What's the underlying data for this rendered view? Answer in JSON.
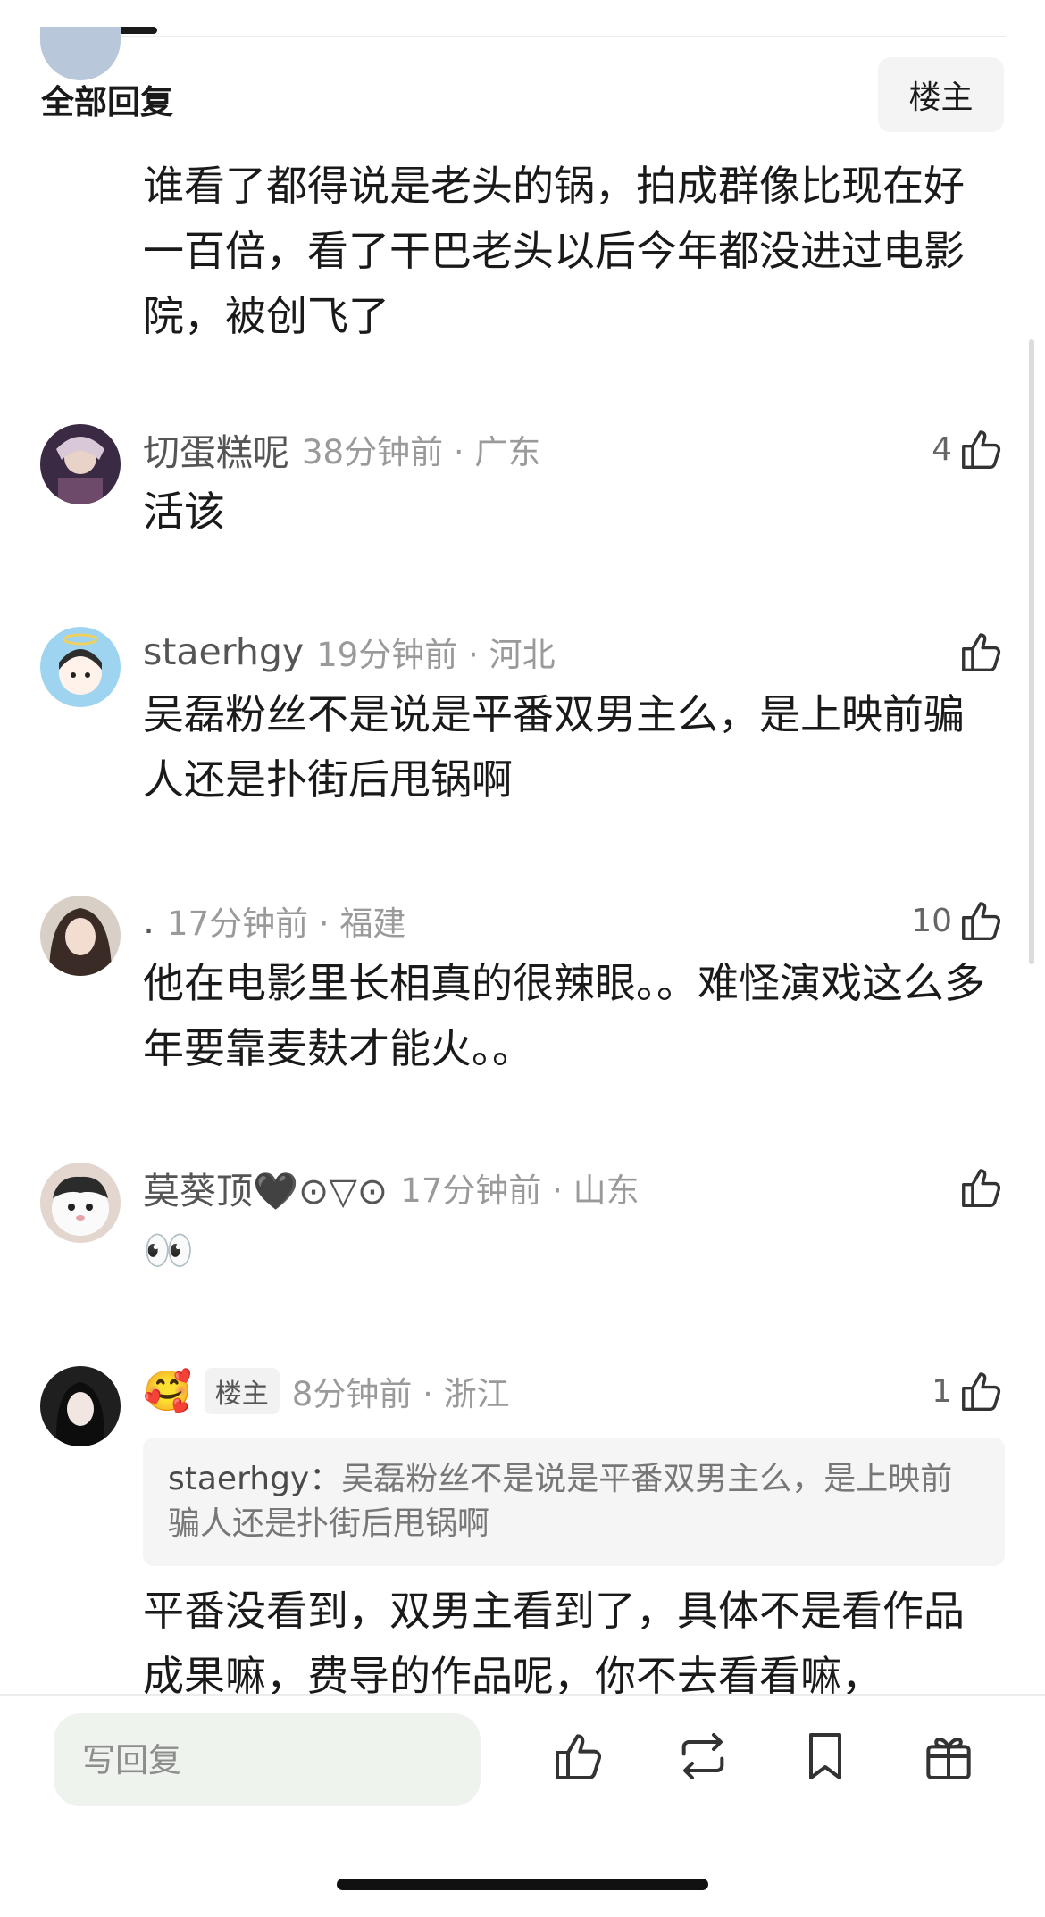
{
  "header": {
    "title": "全部回复",
    "op_filter_label": "楼主"
  },
  "comments": [
    {
      "username": "",
      "time_location": "",
      "likes": "",
      "body": "谁看了都得说是老头的锅，拍成群像比现在好一百倍，看了干巴老头以后今年都没进过电影院，被创飞了"
    },
    {
      "username": "切蛋糕呢",
      "time_location": "38分钟前 · 广东",
      "likes": "4",
      "body": "活该"
    },
    {
      "username": "staerhgy",
      "time_location": "19分钟前 · 河北",
      "likes": "",
      "body": "吴磊粉丝不是说是平番双男主么，是上映前骗人还是扑街后甩锅啊"
    },
    {
      "username": ".",
      "time_location": "17分钟前 · 福建",
      "likes": "10",
      "body": "他在电影里长相真的很辣眼。。难怪演戏这么多年要靠麦麸才能火。。"
    },
    {
      "username": "莫葵顶🖤⊙▽⊙",
      "time_location": "17分钟前 · 山东",
      "likes": "",
      "body": "👀"
    },
    {
      "username": "🥰",
      "badge": "楼主",
      "time_location": "8分钟前 · 浙江",
      "likes": "1",
      "quote_user": "staerhgy：",
      "quote_text": "吴磊粉丝不是说是平番双男主么，是上映前骗人还是扑街后甩锅啊",
      "body": "平番没看到，双男主看到了，具体不是看作品成果嘛，费导的作品呢，你不去看看嘛，"
    }
  ],
  "bottom_bar": {
    "reply_placeholder": "写回复",
    "icons": [
      "thumbs-up-icon",
      "repost-icon",
      "bookmark-icon",
      "gift-icon"
    ]
  },
  "colors": {
    "text": "#1a1a1a",
    "meta": "#9a9a9a",
    "input_bg": "#eef3ee"
  }
}
